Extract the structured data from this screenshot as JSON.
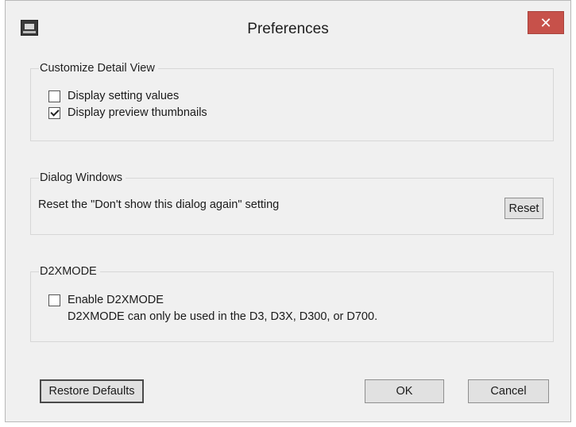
{
  "window": {
    "title": "Preferences",
    "close_glyph": "✕"
  },
  "customize_detail_view": {
    "heading": "Customize Detail View",
    "display_setting_values": {
      "label": "Display setting values",
      "checked": false
    },
    "display_preview_thumbnails": {
      "label": "Display preview thumbnails",
      "checked": true
    }
  },
  "dialog_windows": {
    "heading": "Dialog Windows",
    "reset_description": "Reset the \"Don't show this dialog again\" setting",
    "reset_label": "Reset"
  },
  "d2xmode": {
    "heading": "D2XMODE",
    "enable": {
      "label": "Enable D2XMODE",
      "checked": false
    },
    "note": "D2XMODE can only be used in the D3, D3X, D300, or D700."
  },
  "footer": {
    "restore_defaults_label": "Restore Defaults",
    "ok_label": "OK",
    "cancel_label": "Cancel"
  },
  "icons": {
    "app": "app-icon",
    "close": "close-icon",
    "checkmark": "checkmark-icon"
  }
}
